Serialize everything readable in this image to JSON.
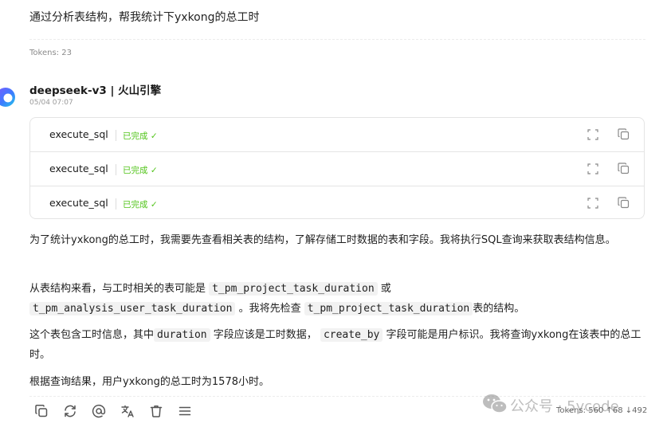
{
  "user_message": {
    "text": "通过分析表结构，帮我统计下yxkong的总工时",
    "tokens": "Tokens: 23"
  },
  "assistant": {
    "model": "deepseek-v3 | 火山引擎",
    "time": "05/04 07:07",
    "tool_calls": [
      {
        "name": "execute_sql",
        "status": "已完成 ✓"
      },
      {
        "name": "execute_sql",
        "status": "已完成 ✓"
      },
      {
        "name": "execute_sql",
        "status": "已完成 ✓"
      }
    ],
    "p1": "为了统计yxkong的总工时，我需要先查看相关表的结构，了解存储工时数据的表和字段。我将执行SQL查询来获取表结构信息。",
    "p2": {
      "a": "从表结构来看，与工时相关的表可能是",
      "code1": "t_pm_project_task_duration",
      "b": "或",
      "code2": "t_pm_analysis_user_task_duration",
      "c": "。我将先检查",
      "code3": "t_pm_project_task_duration",
      "d": "表的结构。"
    },
    "p3": {
      "a": "这个表包含工时信息，其中",
      "code1": "duration",
      "b": "字段应该是工时数据，",
      "code2": "create_by",
      "c": "字段可能是用户标识。我将查询yxkong在该表中的总工时。"
    },
    "p4": "根据查询结果，用户yxkong的总工时为1578小时。",
    "footer_tokens": "Tokens: 560 ↑68 ↓492"
  },
  "watermark": "公众号 · 5ycode",
  "colors": {
    "success": "#52c41a",
    "code_bg": "#f2f2f2",
    "muted": "#8a8a8a"
  }
}
